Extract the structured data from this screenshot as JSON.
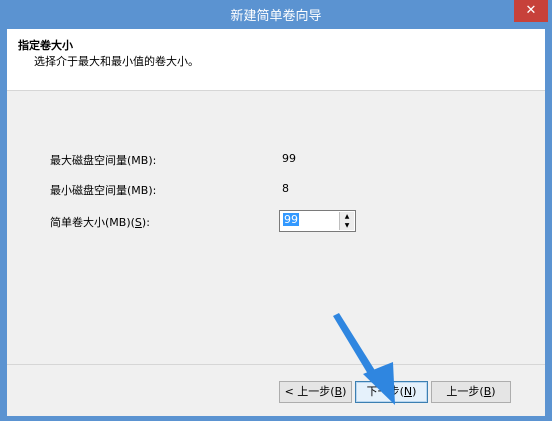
{
  "window": {
    "title": "新建简单卷向导",
    "close_label": "✕"
  },
  "header": {
    "title": "指定卷大小",
    "subtitle": "选择介于最大和最小值的卷大小。"
  },
  "fields": {
    "max_label": "最大磁盘空间量(MB):",
    "max_value": "99",
    "min_label": "最小磁盘空间量(MB):",
    "min_value": "8",
    "size_label_prefix": "简单卷大小(MB)(",
    "size_label_key": "S",
    "size_label_suffix": "):",
    "size_value": "99"
  },
  "buttons": {
    "back_prefix": "< 上一步(",
    "back_key": "B",
    "back_suffix": ")",
    "next_prefix": "下一步(",
    "next_key": "N",
    "next_suffix": ")",
    "third_prefix": "上一步(",
    "third_key": "B",
    "third_suffix": ")"
  },
  "colors": {
    "titlebar": "#5b93d1",
    "close": "#c7413a",
    "arrow": "#2f86e0",
    "selection": "#3399ff"
  },
  "icons": {
    "spin_up": "▲",
    "spin_down": "▼"
  }
}
